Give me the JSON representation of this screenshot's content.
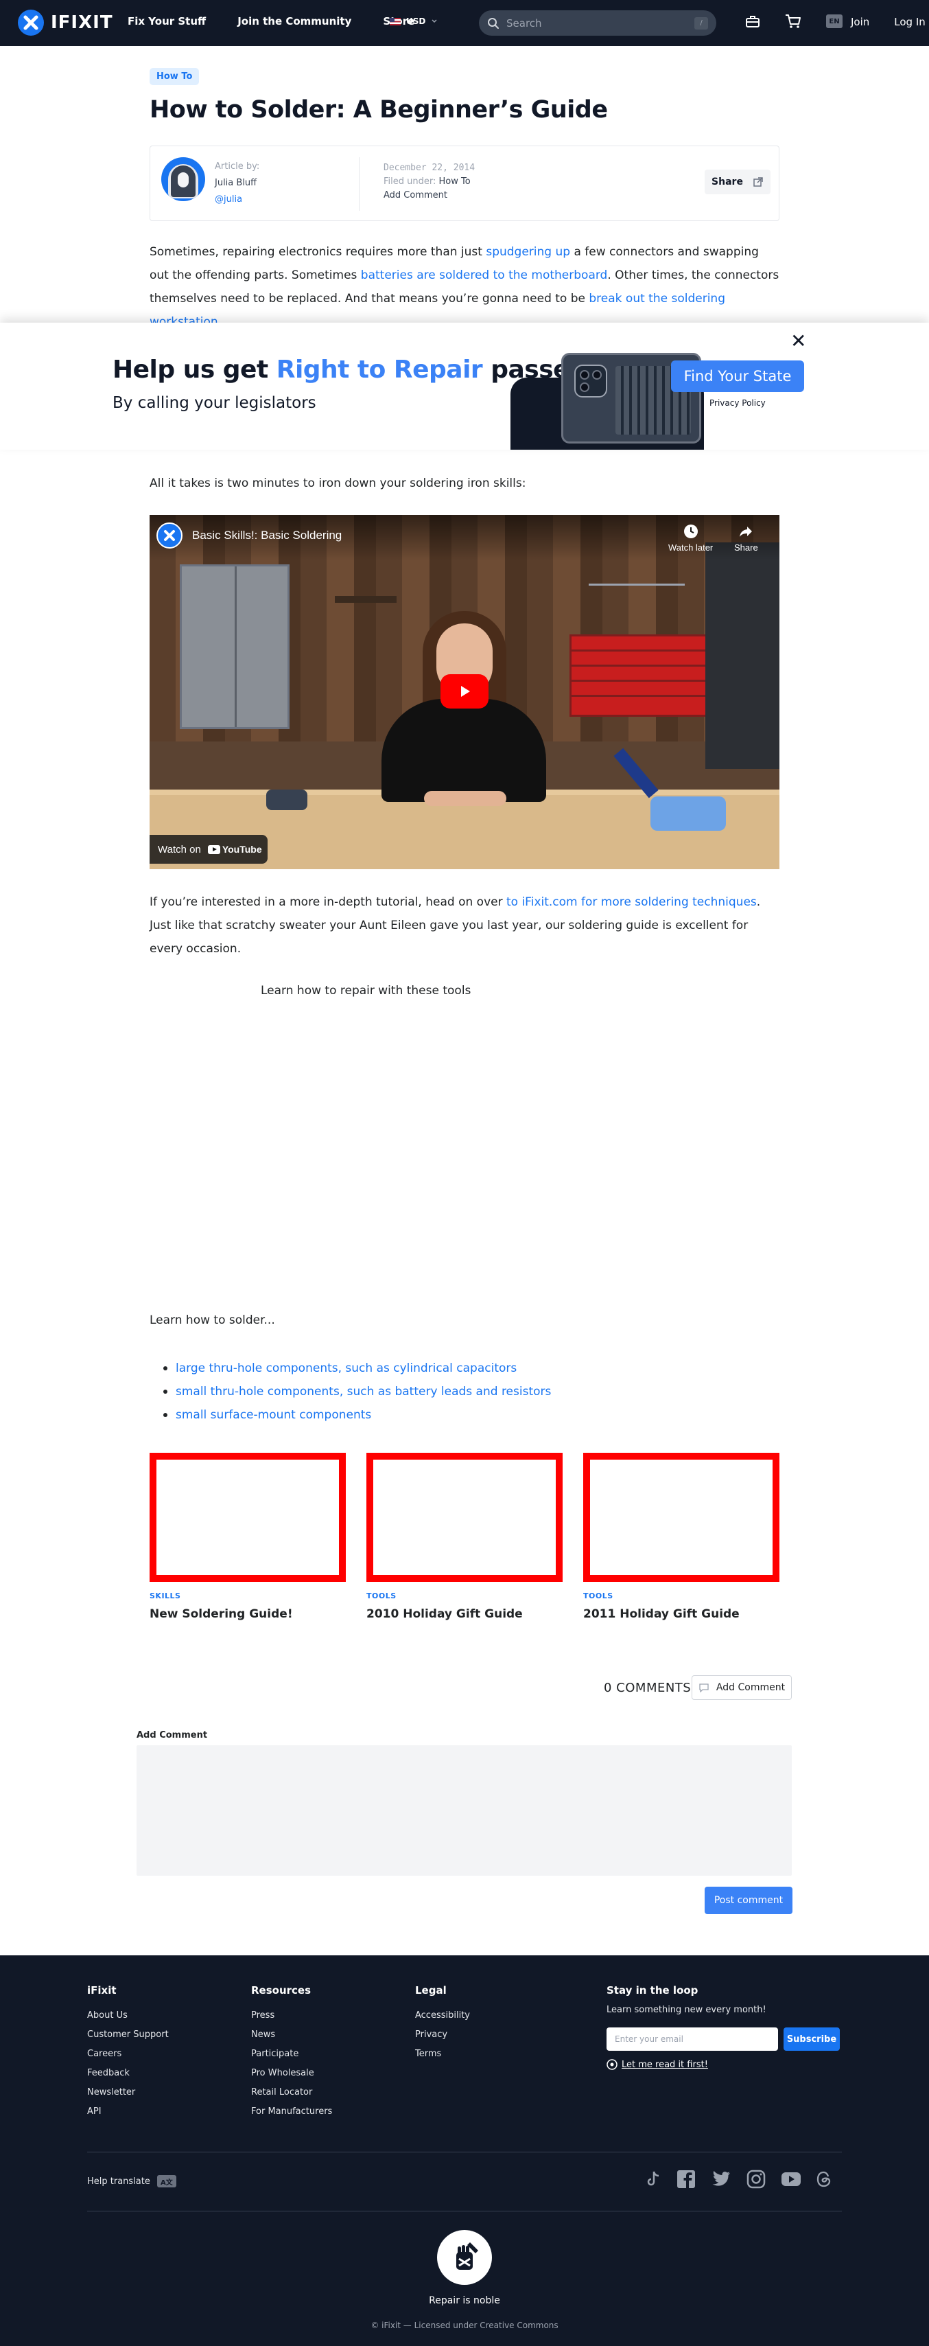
{
  "header": {
    "brand": "IFIXIT",
    "nav": [
      "Fix Your Stuff",
      "Join the Community",
      "Store"
    ],
    "currency": "USD",
    "search_placeholder": "Search",
    "search_shortcut": "/",
    "language_code": "EN",
    "join": "Join",
    "login": "Log In"
  },
  "article": {
    "category_badge": "How To",
    "title": "How to Solder: A Beginner’s Guide",
    "author_label": "Article by:",
    "author_name": "Julia Bluff",
    "author_handle": "@julia",
    "date": "December 22, 2014",
    "filed_label": "Filed under:",
    "filed_value": "How To",
    "add_comment": "Add Comment",
    "share": "Share",
    "intro": {
      "t1": "Sometimes, repairing electronics requires more than just ",
      "l1": "spudgering up",
      "t2": " a few connectors and swapping out the offending parts. Sometimes ",
      "l2": "batteries are soldered to the motherboard",
      "t3": ". Other times, the connectors themselves need to be replaced. And that means you’re gonna need to be ",
      "l3": "break out the soldering workstation",
      "t4": "."
    },
    "para2": "All it takes is two minutes to iron down your soldering iron skills:",
    "para3": {
      "t1": "If you’re interested in a more in-depth tutorial, head on over ",
      "l1": "to iFixit.com for more soldering techniques",
      "t2": ". Just like that scratchy sweater your Aunt Eileen gave you last year, our soldering guide is excellent for every occasion."
    },
    "tools_label": "Learn how to repair with these tools",
    "learn_label": "Learn how to solder...",
    "solder_links": [
      "large thru-hole components, such as cylindrical capacitors",
      "small thru-hole components, such as battery leads and resistors",
      "small surface-mount components"
    ]
  },
  "video": {
    "title": "Basic Skills!: Basic Soldering",
    "watch_later": "Watch later",
    "share": "Share",
    "watch_on": "Watch on",
    "youtube": "YouTube"
  },
  "banner": {
    "title_a": "Help us get ",
    "title_hl": "Right to Repair",
    "title_b": " passed",
    "subtitle": "By calling your legislators",
    "cta": "Find Your State",
    "privacy": "Privacy Policy",
    "close": "✕"
  },
  "related": [
    {
      "category": "SKILLS",
      "title": "New Soldering Guide!"
    },
    {
      "category": "TOOLS",
      "title": "2010 Holiday Gift Guide"
    },
    {
      "category": "TOOLS",
      "title": "2011 Holiday Gift Guide"
    }
  ],
  "comments": {
    "count": "0 COMMENTS",
    "add_button": "Add Comment",
    "form_label": "Add Comment",
    "post_button": "Post comment"
  },
  "footer": {
    "col1": {
      "title": "iFixit",
      "links": [
        "About Us",
        "Customer Support",
        "Careers",
        "Feedback",
        "Newsletter",
        "API"
      ]
    },
    "col2": {
      "title": "Resources",
      "links": [
        "Press",
        "News",
        "Participate",
        "Pro Wholesale",
        "Retail Locator",
        "For Manufacturers"
      ]
    },
    "col3": {
      "title": "Legal",
      "links": [
        "Accessibility",
        "Privacy",
        "Terms"
      ]
    },
    "newsletter": {
      "title": "Stay in the loop",
      "desc": "Learn something new every month!",
      "placeholder": "Enter your email",
      "button": "Subscribe",
      "read_first": "Let me read it first!"
    },
    "help_translate": "Help translate",
    "tagline": "Repair is noble",
    "copyright": "© iFixit — Licensed under Creative Commons"
  },
  "colors": {
    "accent": "#1975f1",
    "banner_accent": "#3b82f6",
    "header_bg": "#111827",
    "card_border": "#ff0000"
  }
}
